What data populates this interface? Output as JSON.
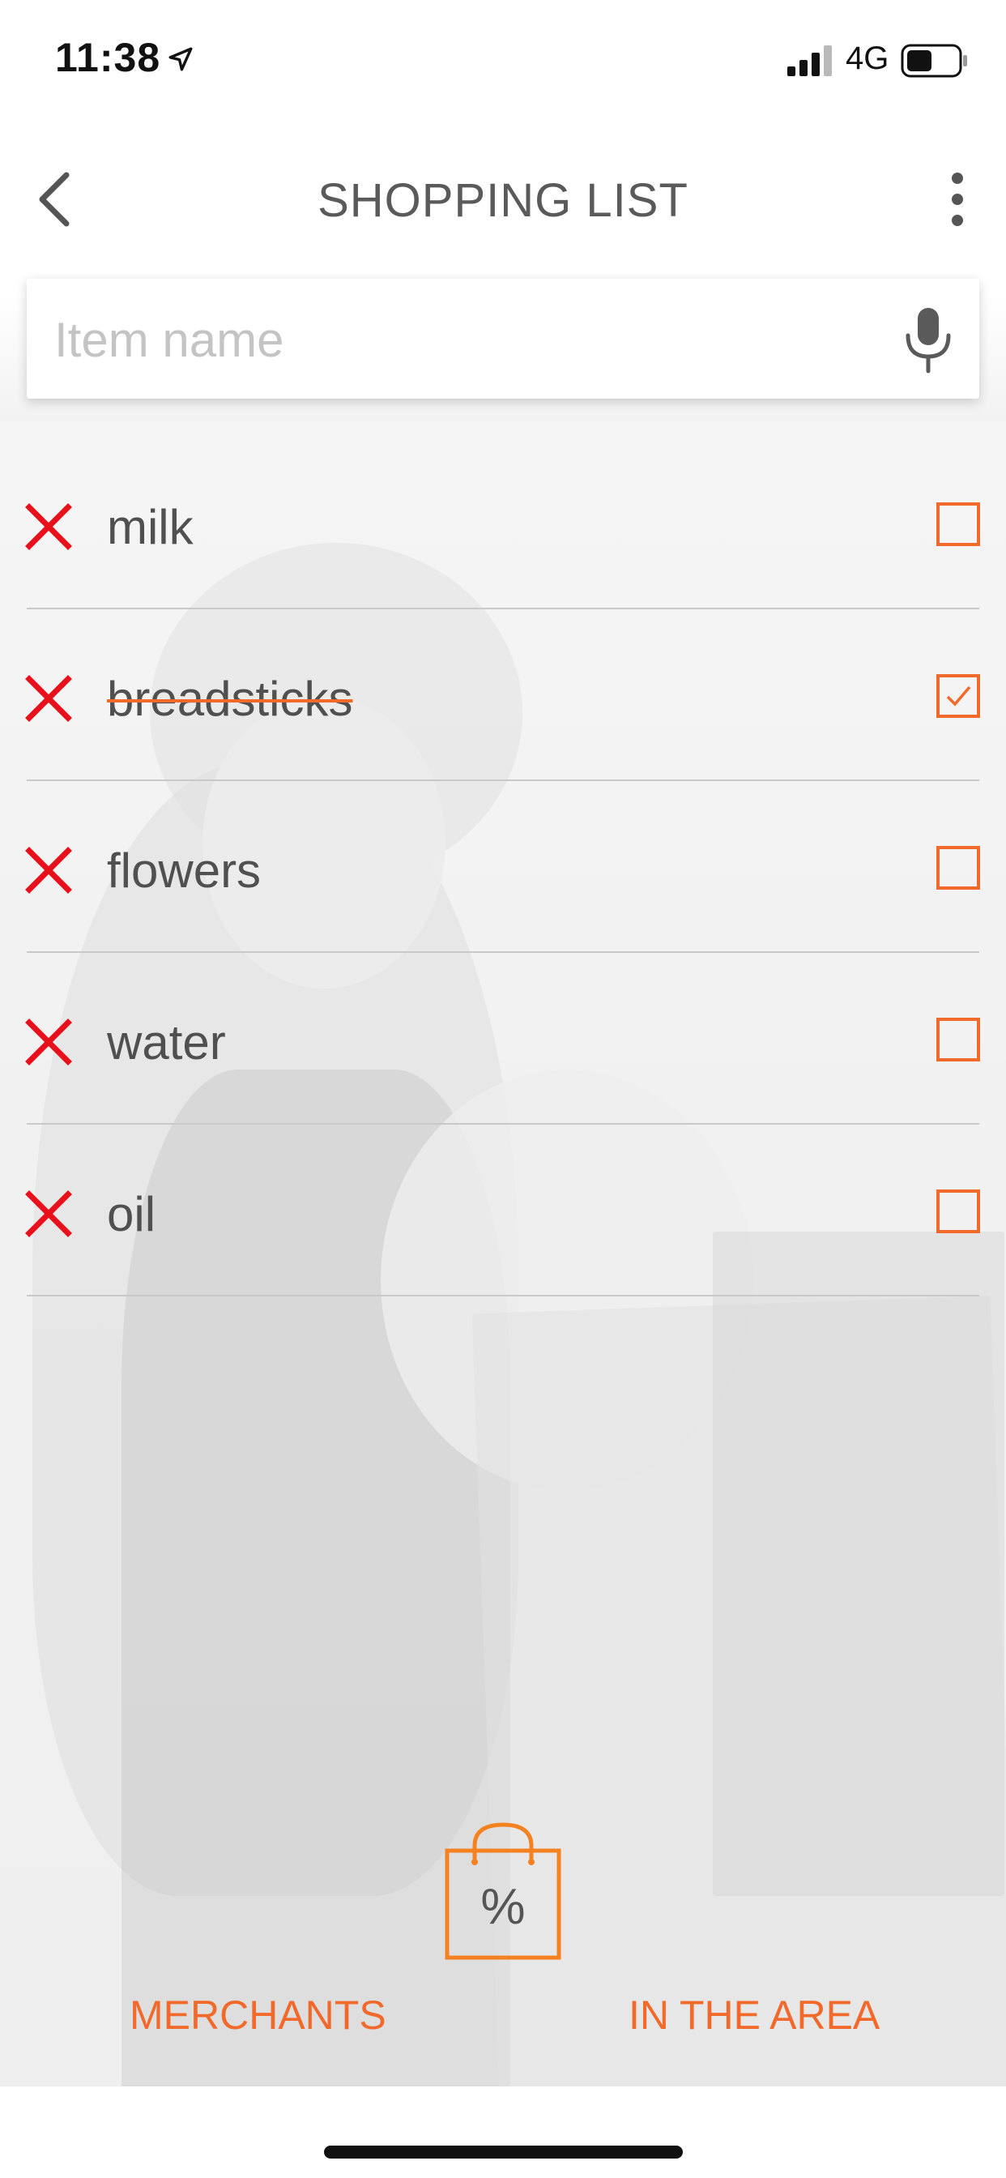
{
  "status_bar": {
    "time": "11:38",
    "network": "4G",
    "icons": [
      "location-arrow-icon",
      "signal-icon",
      "battery-icon"
    ]
  },
  "nav": {
    "title": "SHOPPING LIST",
    "back_icon": "chevron-left-icon",
    "menu_icon": "more-vertical-icon"
  },
  "search": {
    "placeholder": "Item name",
    "value": "",
    "icon": "microphone-icon"
  },
  "items": [
    {
      "label": "milk",
      "checked": false
    },
    {
      "label": "breadsticks",
      "checked": true
    },
    {
      "label": "flowers",
      "checked": false
    },
    {
      "label": "water",
      "checked": false
    },
    {
      "label": "oil",
      "checked": false
    }
  ],
  "bottom": {
    "merchants_label": "MERCHANTS",
    "area_label": "IN THE AREA",
    "center_icon": "shopping-bag-percent-icon",
    "center_icon_text": "%"
  },
  "colors": {
    "accent": "#f26a2b",
    "delete": "#e8111b",
    "text": "#505050"
  }
}
